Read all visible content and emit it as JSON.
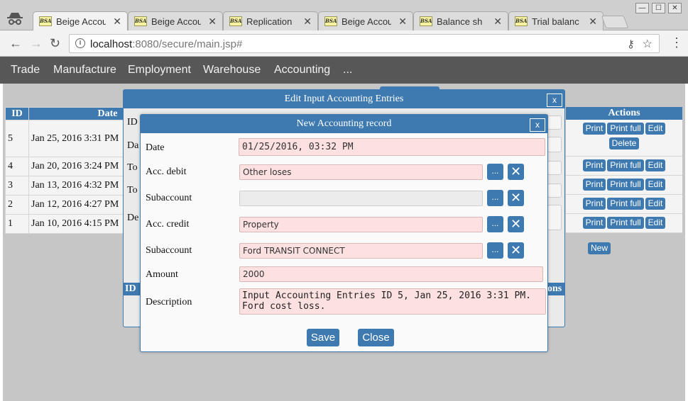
{
  "browser": {
    "tabs": [
      {
        "favicon": "BSA",
        "label": "Beige Accou",
        "close": "✕"
      },
      {
        "favicon": "BSA",
        "label": "Beige Accou",
        "close": "✕"
      },
      {
        "favicon": "BSA",
        "label": "Replication",
        "close": "✕"
      },
      {
        "favicon": "BSA",
        "label": "Beige Accou",
        "close": "✕"
      },
      {
        "favicon": "BSA",
        "label": "Balance sh",
        "close": "✕"
      },
      {
        "favicon": "BSA",
        "label": "Trial balanc",
        "close": "✕"
      }
    ],
    "url_host": "localhost",
    "url_rest": ":8080/secure/main.jsp#",
    "window_controls": {
      "minimize": "—",
      "maximize": "☐",
      "close": "✕"
    }
  },
  "menu": [
    "Trade",
    "Manufacture",
    "Employment",
    "Warehouse",
    "Accounting",
    "..."
  ],
  "list": {
    "headers": {
      "id": "ID",
      "date": "Date",
      "actions": "Actions"
    },
    "rows": [
      {
        "id": "5",
        "date": "Jan 25, 2016 3:31 PM"
      },
      {
        "id": "4",
        "date": "Jan 20, 2016 3:24 PM"
      },
      {
        "id": "3",
        "date": "Jan 13, 2016 4:32 PM"
      },
      {
        "id": "2",
        "date": "Jan 12, 2016 4:27 PM"
      },
      {
        "id": "1",
        "date": "Jan 10, 2016 4:15 PM"
      }
    ],
    "buttons": {
      "print": "Print",
      "print_full": "Print full",
      "edit": "Edit",
      "delete": "Delete",
      "new": "New"
    }
  },
  "back_dialog": {
    "title": "Edit Input Accounting Entries",
    "close": "x",
    "fragments": [
      "ID",
      "Da",
      "To",
      "To",
      "De"
    ],
    "bottom_header_left": "ID",
    "bottom_header_right": "ons"
  },
  "dialog": {
    "title": "New Accounting record",
    "close": "x",
    "fields": {
      "date": {
        "label": "Date",
        "value": "01/25/2016, 03:32 PM"
      },
      "acc_debit": {
        "label": "Acc. debit",
        "value": "Other loses"
      },
      "sub_debit": {
        "label": "Subaccount",
        "value": ""
      },
      "acc_credit": {
        "label": "Acc. credit",
        "value": "Property"
      },
      "sub_credit": {
        "label": "Subaccount",
        "value": "Ford TRANSIT CONNECT"
      },
      "amount": {
        "label": "Amount",
        "value": "2000"
      },
      "description": {
        "label": "Description",
        "line1": "Input Accounting Entries ID 5, Jan 25, 2016 3:31 PM.",
        "line2": "Ford cost loss."
      }
    },
    "pick_label": "...",
    "clear_label": "✕",
    "save": "Save",
    "close_button": "Close"
  }
}
